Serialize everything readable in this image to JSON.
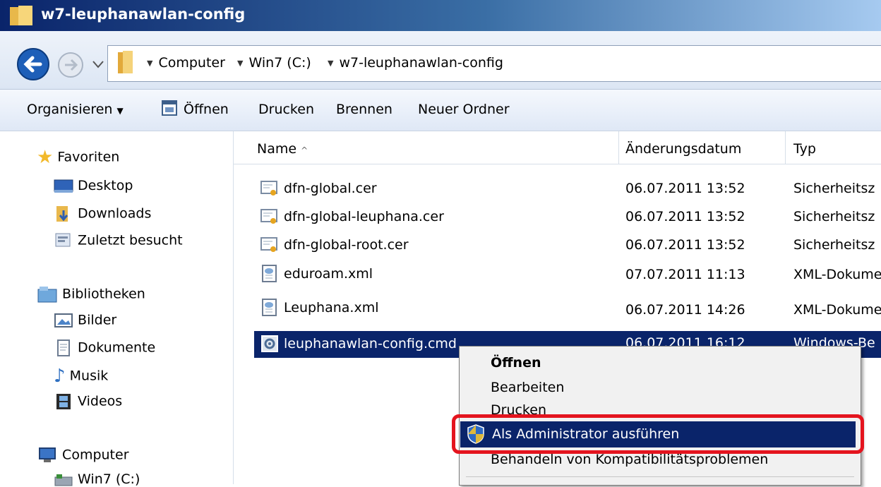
{
  "window": {
    "title": "w7-leuphanawlan-config"
  },
  "address": {
    "crumbs": [
      "Computer",
      "Win7 (C:)",
      "w7-leuphanawlan-config"
    ]
  },
  "toolbar": {
    "organize": "Organisieren",
    "open": "Öffnen",
    "print": "Drucken",
    "burn": "Brennen",
    "new_folder": "Neuer Ordner"
  },
  "nav": {
    "favorites": "Favoriten",
    "desktop": "Desktop",
    "downloads": "Downloads",
    "recent": "Zuletzt besucht",
    "libraries": "Bibliotheken",
    "pictures": "Bilder",
    "documents": "Dokumente",
    "music": "Musik",
    "videos": "Videos",
    "computer": "Computer",
    "drive": "Win7 (C:)"
  },
  "columns": {
    "name": "Name",
    "date": "Änderungsdatum",
    "type": "Typ"
  },
  "files": [
    {
      "name": "dfn-global.cer",
      "date": "06.07.2011 13:52",
      "type": "Sicherheitsz"
    },
    {
      "name": "dfn-global-leuphana.cer",
      "date": "06.07.2011 13:52",
      "type": "Sicherheitsz"
    },
    {
      "name": "dfn-global-root.cer",
      "date": "06.07.2011 13:52",
      "type": "Sicherheitsz"
    },
    {
      "name": "eduroam.xml",
      "date": "07.07.2011 11:13",
      "type": "XML-Dokume"
    },
    {
      "name": "Leuphana.xml",
      "date": "06.07.2011 14:26",
      "type": "XML-Dokume"
    },
    {
      "name": "leuphanawlan-config.cmd",
      "date": "06.07.2011 16:12",
      "type": "Windows-Be"
    }
  ],
  "context_menu": {
    "open": "Öffnen",
    "edit": "Bearbeiten",
    "print": "Drucken",
    "run_as_admin": "Als Administrator ausführen",
    "troubleshoot": "Behandeln von Kompatibilitätsproblemen"
  },
  "colors": {
    "selection": "#0a246a",
    "highlight_box": "#e4141e"
  }
}
